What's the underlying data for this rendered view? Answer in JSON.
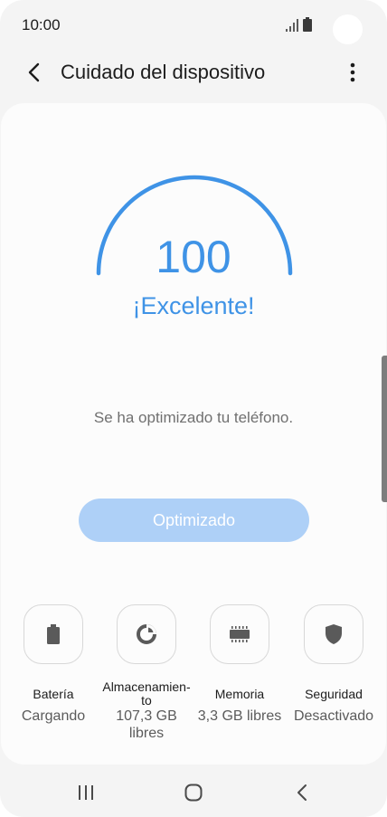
{
  "status_bar": {
    "time": "10:00"
  },
  "app_bar": {
    "title": "Cuidado del dispositivo",
    "back_icon": "chevron-left-icon",
    "more_icon": "more-vertical-icon"
  },
  "score": {
    "value": "100",
    "status": "¡Excelente!",
    "gauge_fraction": 1.0,
    "accent_color": "#3f93e6"
  },
  "message": "Se ha optimizado tu teléfono.",
  "optimize_button": {
    "label": "Optimizado",
    "color": "#aed0f7"
  },
  "tiles": [
    {
      "icon": "battery-icon",
      "label": "Batería",
      "value": "Cargando"
    },
    {
      "icon": "storage-pie-icon",
      "label": "Almacenamien-\nto",
      "value": "107,3 GB libres"
    },
    {
      "icon": "memory-chip-icon",
      "label": "Memoria",
      "value": "3,3 GB libres"
    },
    {
      "icon": "shield-icon",
      "label": "Seguridad",
      "value": "Desactivado"
    }
  ],
  "nav_bar": {
    "recents_icon": "recents-icon",
    "home_icon": "home-icon",
    "back_icon": "nav-back-icon"
  }
}
